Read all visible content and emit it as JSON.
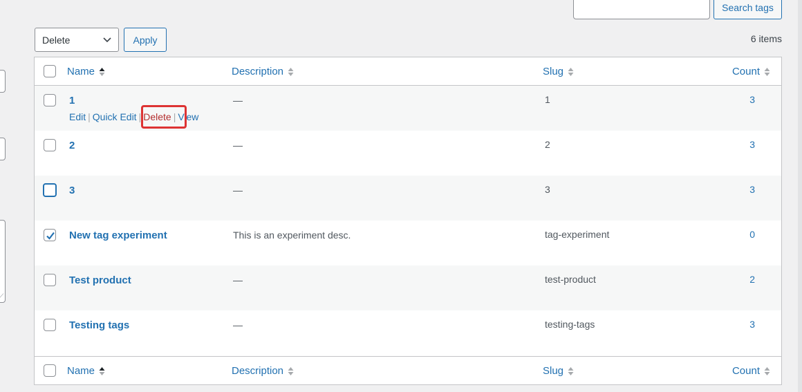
{
  "search": {
    "placeholder": "",
    "value": "",
    "button_label": "Search tags"
  },
  "bulk_actions": {
    "selected": "Delete",
    "apply_label": "Apply"
  },
  "items_count": "6 items",
  "table": {
    "columns": {
      "name": "Name",
      "description": "Description",
      "slug": "Slug",
      "count": "Count"
    },
    "sorted_by": "name",
    "sort_direction": "ascending",
    "rows": [
      {
        "name": "1",
        "description": "—",
        "slug": "1",
        "count": "3",
        "checked": false,
        "focused": false,
        "row_actions": {
          "edit": "Edit",
          "quick_edit": "Quick Edit",
          "delete": "Delete",
          "view": "View",
          "separator": "|"
        }
      },
      {
        "name": "2",
        "description": "—",
        "slug": "2",
        "count": "3",
        "checked": false,
        "focused": false
      },
      {
        "name": "3",
        "description": "—",
        "slug": "3",
        "count": "3",
        "checked": false,
        "focused": true
      },
      {
        "name": "New tag experiment",
        "description": "This is an experiment desc.",
        "slug": "tag-experiment",
        "count": "0",
        "checked": true,
        "focused": false
      },
      {
        "name": "Test product",
        "description": "—",
        "slug": "test-product",
        "count": "2",
        "checked": false,
        "focused": false
      },
      {
        "name": "Testing tags",
        "description": "—",
        "slug": "testing-tags",
        "count": "3",
        "checked": false,
        "focused": false
      }
    ]
  },
  "icons": {
    "select_chevron": "chevron-down-icon",
    "sort_active": "sort-asc-icon",
    "sort_inactive": "sort-icon",
    "checkbox_check": "checkmark-icon",
    "resize": "resize-grip-icon"
  },
  "colors": {
    "accent": "#2271b1",
    "delete": "#b32d2e",
    "highlight": "#dd3333",
    "background": "#f0f0f1",
    "alt_row": "#f6f7f7"
  }
}
